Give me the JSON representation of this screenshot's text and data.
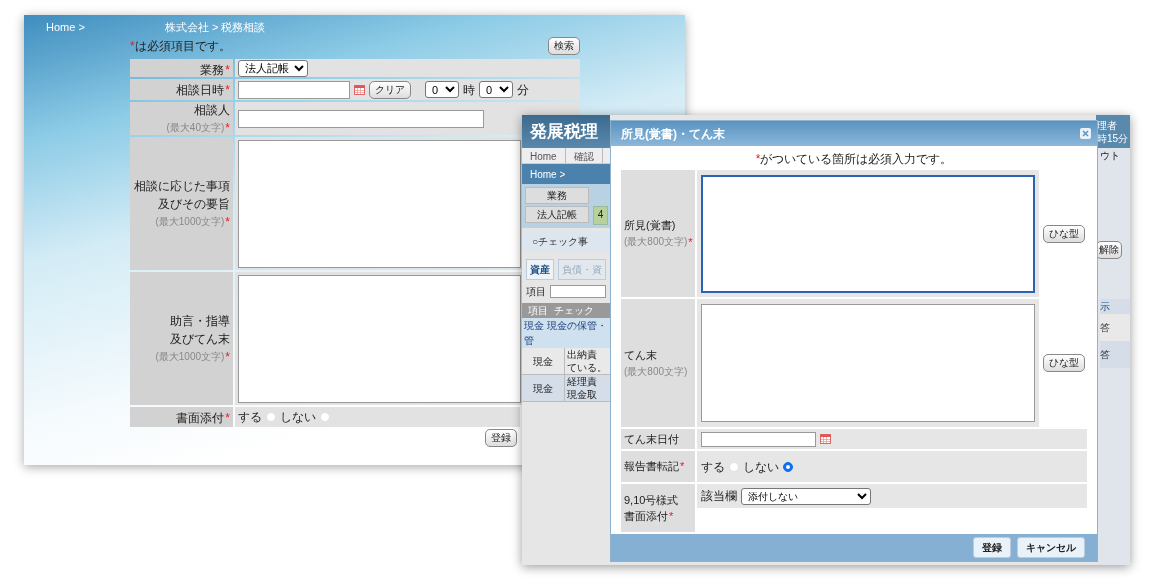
{
  "back_window": {
    "breadcrumb": [
      "Home >",
      "株式会社 > 税務相談"
    ],
    "required_note": {
      "mark": "*",
      "text": "は必須項目です。"
    },
    "search_button": "検索",
    "rows": [
      {
        "kind": "select",
        "label_lines": [
          "業務"
        ],
        "required_mark": "*",
        "value": "法人記帳"
      },
      {
        "kind": "datetime",
        "label_lines": [
          "相談日時"
        ],
        "required_mark": "*",
        "clear_button": "クリア",
        "hour": "0",
        "hour_unit": "時",
        "minute": "0",
        "minute_unit": "分"
      },
      {
        "kind": "text",
        "label_lines": [
          "相談人"
        ],
        "hint": "(最大40文字)",
        "required_mark": "*"
      },
      {
        "kind": "textarea",
        "label_lines": [
          "相談に応じた事項",
          "及びその要旨"
        ],
        "hint": "(最大1000文字)",
        "required_mark": "*"
      },
      {
        "kind": "textarea",
        "label_lines": [
          "助言・指導",
          "及びてん末"
        ],
        "hint": "(最大1000文字)",
        "required_mark": "*"
      },
      {
        "kind": "radio",
        "label_lines": [
          "書面添付"
        ],
        "required_mark": "*",
        "options": [
          {
            "label": "する",
            "selected": false
          },
          {
            "label": "しない",
            "selected": false
          }
        ]
      }
    ],
    "submit_button": "登録"
  },
  "app_window": {
    "title": "発展税理",
    "nav": [
      "Home",
      "確認"
    ],
    "breadcrumb": "Home >",
    "filter": {
      "heading": "業務",
      "value": "法人記帳",
      "count": "4"
    },
    "check_toggle": "○チェック事",
    "tabs": [
      {
        "label": "資産",
        "selected": true
      },
      {
        "label": "負債・資",
        "selected": false
      }
    ],
    "search_label": "項目",
    "table": {
      "columns": [
        "項目",
        "チェック"
      ],
      "group": "現金 現金の保管・管",
      "rows": [
        {
          "item": "現金",
          "lines": [
            "出納責",
            "ている。"
          ]
        },
        {
          "item": "現金",
          "lines": [
            "経理責",
            "現金取"
          ]
        }
      ]
    },
    "right_edge": {
      "header_info": [
        "理者",
        "時15分"
      ],
      "nav_text": "ウト",
      "button": "解除",
      "cells": [
        "示",
        "答",
        "答"
      ]
    }
  },
  "dialog": {
    "title": "所見(覚書)・てん末",
    "required_note": {
      "mark": "*",
      "text": "がついている箇所は必須入力です。"
    },
    "rows": [
      {
        "kind": "textarea",
        "label_lines": [
          "所見(覚書)"
        ],
        "hint": "(最大800文字)",
        "required_mark": "*",
        "focused": true,
        "template_button": "ひな型"
      },
      {
        "kind": "textarea",
        "label_lines": [
          "てん末"
        ],
        "hint": "(最大800文字)",
        "focused": false,
        "template_button": "ひな型"
      },
      {
        "kind": "date",
        "label_lines": [
          "てん末日付"
        ]
      },
      {
        "kind": "radio",
        "label_lines": [
          "報告書転記"
        ],
        "required_mark": "*",
        "options": [
          {
            "label": "する",
            "selected": false
          },
          {
            "label": "しない",
            "selected": true
          }
        ]
      },
      {
        "kind": "select",
        "label_lines": [
          "9,10号様式",
          "書面添付"
        ],
        "required_mark": "*",
        "prefix": "該当欄",
        "value": "添付しない"
      }
    ],
    "buttons": [
      "登録",
      "キャンセル"
    ]
  }
}
